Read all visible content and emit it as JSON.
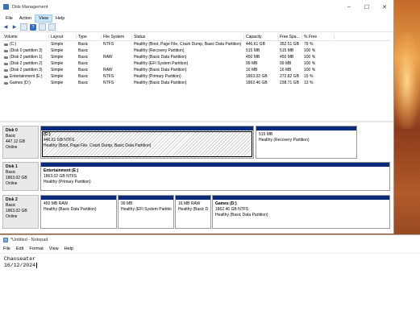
{
  "dm": {
    "title": "Disk Management",
    "window_buttons": {
      "minimize": "–",
      "maximize": "☐",
      "close": "✕"
    },
    "menu": [
      "File",
      "Action",
      "View",
      "Help"
    ],
    "active_menu": "View",
    "toolbar_icons": [
      "back-arrow-icon",
      "forward-arrow-icon",
      "properties-icon",
      "help-icon",
      "refresh-icon",
      "grid-icon"
    ],
    "columns": [
      "Volume",
      "Layout",
      "Type",
      "File System",
      "Status",
      "Capacity",
      "Free Spa...",
      "% Free"
    ],
    "rows": [
      [
        "(C:)",
        "Simple",
        "Basic",
        "NTFS",
        "Healthy (Boot, Page File, Crash Dump, Basic Data Partition)",
        "446.61 GB",
        "352.51 GB",
        "79 %"
      ],
      [
        "(Disk 0 partition 3)",
        "Simple",
        "Basic",
        "",
        "Healthy (Recovery Partition)",
        "515 MB",
        "515 MB",
        "100 %"
      ],
      [
        "(Disk 2 partition 1)",
        "Simple",
        "Basic",
        "RAW",
        "Healthy (Basic Data Partition)",
        "450 MB",
        "450 MB",
        "100 %"
      ],
      [
        "(Disk 2 partition 2)",
        "Simple",
        "Basic",
        "",
        "Healthy (EFI System Partition)",
        "99 MB",
        "99 MB",
        "100 %"
      ],
      [
        "(Disk 2 partition 3)",
        "Simple",
        "Basic",
        "RAW",
        "Healthy (Basic Data Partition)",
        "16 MB",
        "16 MB",
        "100 %"
      ],
      [
        "Entertainment (E:)",
        "Simple",
        "Basic",
        "NTFS",
        "Healthy (Primary Partition)",
        "1863.02 GB",
        "272.82 GB",
        "15 %"
      ],
      [
        "Games (D:)",
        "Simple",
        "Basic",
        "NTFS",
        "Healthy (Basic Data Partition)",
        "1862.46 GB",
        "238.71 GB",
        "13 %"
      ]
    ],
    "disks": [
      {
        "name": "Disk 0",
        "type": "Basic",
        "size": "447.12 GB",
        "status": "Online",
        "partitions": [
          {
            "name": "(C:)",
            "size": "446.61 GB NTFS",
            "status": "Healthy (Boot, Page File, Crash Dump, Basic Data Partition)"
          },
          {
            "name": "",
            "size": "515 MB",
            "status": "Healthy (Recovery Partition)"
          }
        ]
      },
      {
        "name": "Disk 1",
        "type": "Basic",
        "size": "1863.02 GB",
        "status": "Online",
        "partitions": [
          {
            "name": "Entertainment  (E:)",
            "size": "1863.02 GB NTFS",
            "status": "Healthy (Primary Partition)"
          }
        ]
      },
      {
        "name": "Disk 2",
        "type": "Basic",
        "size": "1863.02 GB",
        "status": "Online",
        "partitions": [
          {
            "name": "",
            "size": "450 MB RAW",
            "status": "Healthy (Basic Data Partition)"
          },
          {
            "name": "",
            "size": "99 MB",
            "status": "Healthy (EFI System Partitio"
          },
          {
            "name": "",
            "size": "16 MB RAW",
            "status": "Healthy (Basic D"
          },
          {
            "name": "Games  (D:)",
            "size": "1862.46 GB NTFS",
            "status": "Healthy (Basic Data Partition)"
          }
        ]
      }
    ]
  },
  "notepad": {
    "title": "*Untitled - Notepad",
    "menu": [
      "File",
      "Edit",
      "Format",
      "View",
      "Help"
    ],
    "lines": [
      "Chaoseater",
      "16/12/2024"
    ]
  },
  "colors": {
    "partition_band": "#0b2a7a",
    "menu_highlight": "#cce4f7"
  }
}
